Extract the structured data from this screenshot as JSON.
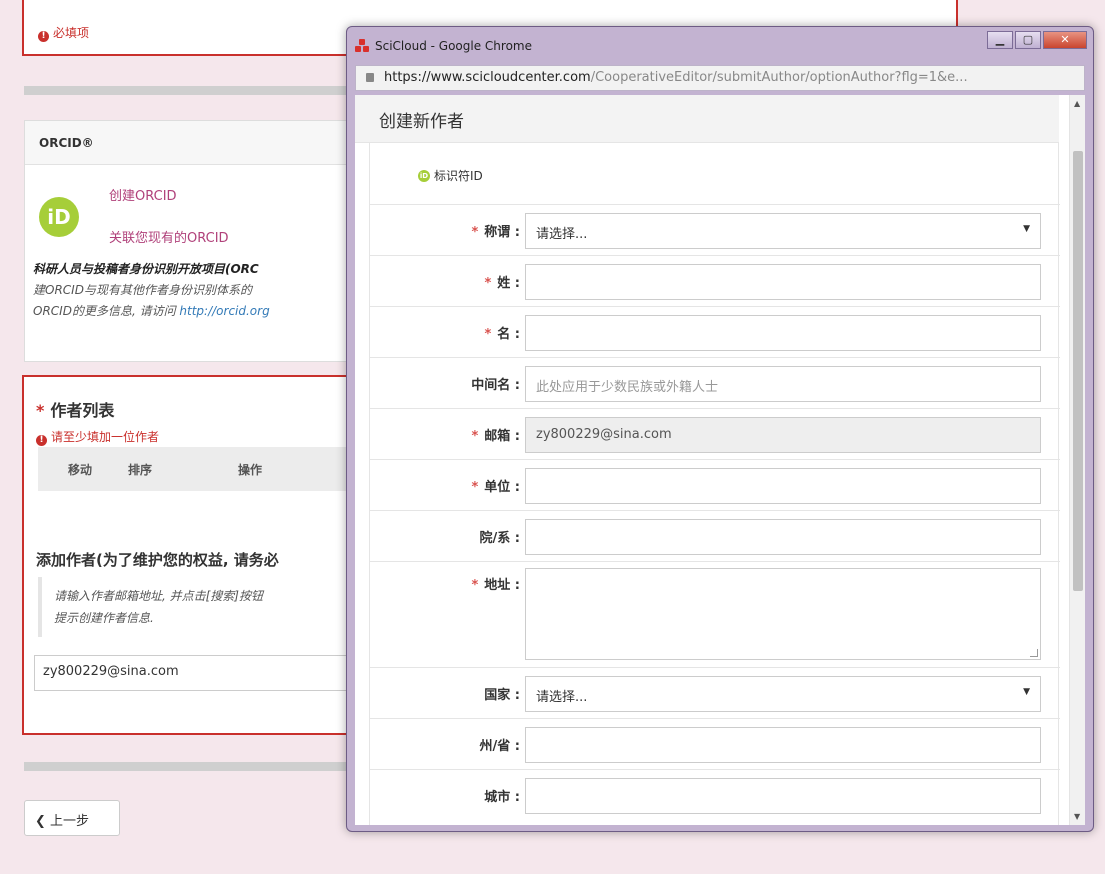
{
  "background": {
    "required_note": "必填项",
    "orcid": {
      "header": "ORCID®",
      "logo_text": "iD",
      "create_link": "创建ORCID",
      "associate_link": "关联您现有的ORCID",
      "desc_bold": "科研人员与投稿者身份识别开放项目(ORC",
      "desc_line2": "建ORCID与现有其他作者身份识别体系的",
      "desc_line3_prefix": "ORCID的更多信息, 请访问",
      "desc_line3_link": "http://orcid.org"
    },
    "authors": {
      "title": "作者列表",
      "error": "请至少填加一位作者",
      "columns": [
        "移动",
        "排序",
        "操作"
      ],
      "add_title": "添加作者(为了维护您的权益, 请务必",
      "hint_line1": "请输入作者邮箱地址, 并点击[搜索]按钮",
      "hint_line2": "提示创建作者信息.",
      "email_value": "zy800229@sina.com"
    },
    "prev_button": "上一步"
  },
  "popup": {
    "window_title": "SciCloud - Google Chrome",
    "url_domain": "https://www.scicloudcenter.com",
    "url_path": "/CooperativeEditor/submitAuthor/optionAuthor?flg=1&e...",
    "form_title": "创建新作者",
    "identifier_label": "标识符ID",
    "fields": [
      {
        "label": "称谓 :",
        "required": true,
        "type": "select",
        "value": "请选择..."
      },
      {
        "label": "姓 :",
        "required": true,
        "type": "text",
        "value": ""
      },
      {
        "label": "名 :",
        "required": true,
        "type": "text",
        "value": ""
      },
      {
        "label": "中间名 :",
        "required": false,
        "type": "text",
        "placeholder": "此处应用于少数民族或外籍人士"
      },
      {
        "label": "邮箱 :",
        "required": true,
        "type": "disabled",
        "value": "zy800229@sina.com"
      },
      {
        "label": "单位 :",
        "required": true,
        "type": "text",
        "value": ""
      },
      {
        "label": "院/系 :",
        "required": false,
        "type": "text",
        "value": ""
      },
      {
        "label": "地址 :",
        "required": true,
        "type": "textarea",
        "value": ""
      },
      {
        "label": "国家 :",
        "required": false,
        "type": "select",
        "value": "请选择..."
      },
      {
        "label": "州/省 :",
        "required": false,
        "type": "text",
        "value": ""
      },
      {
        "label": "城市 :",
        "required": false,
        "type": "text",
        "value": ""
      }
    ]
  }
}
